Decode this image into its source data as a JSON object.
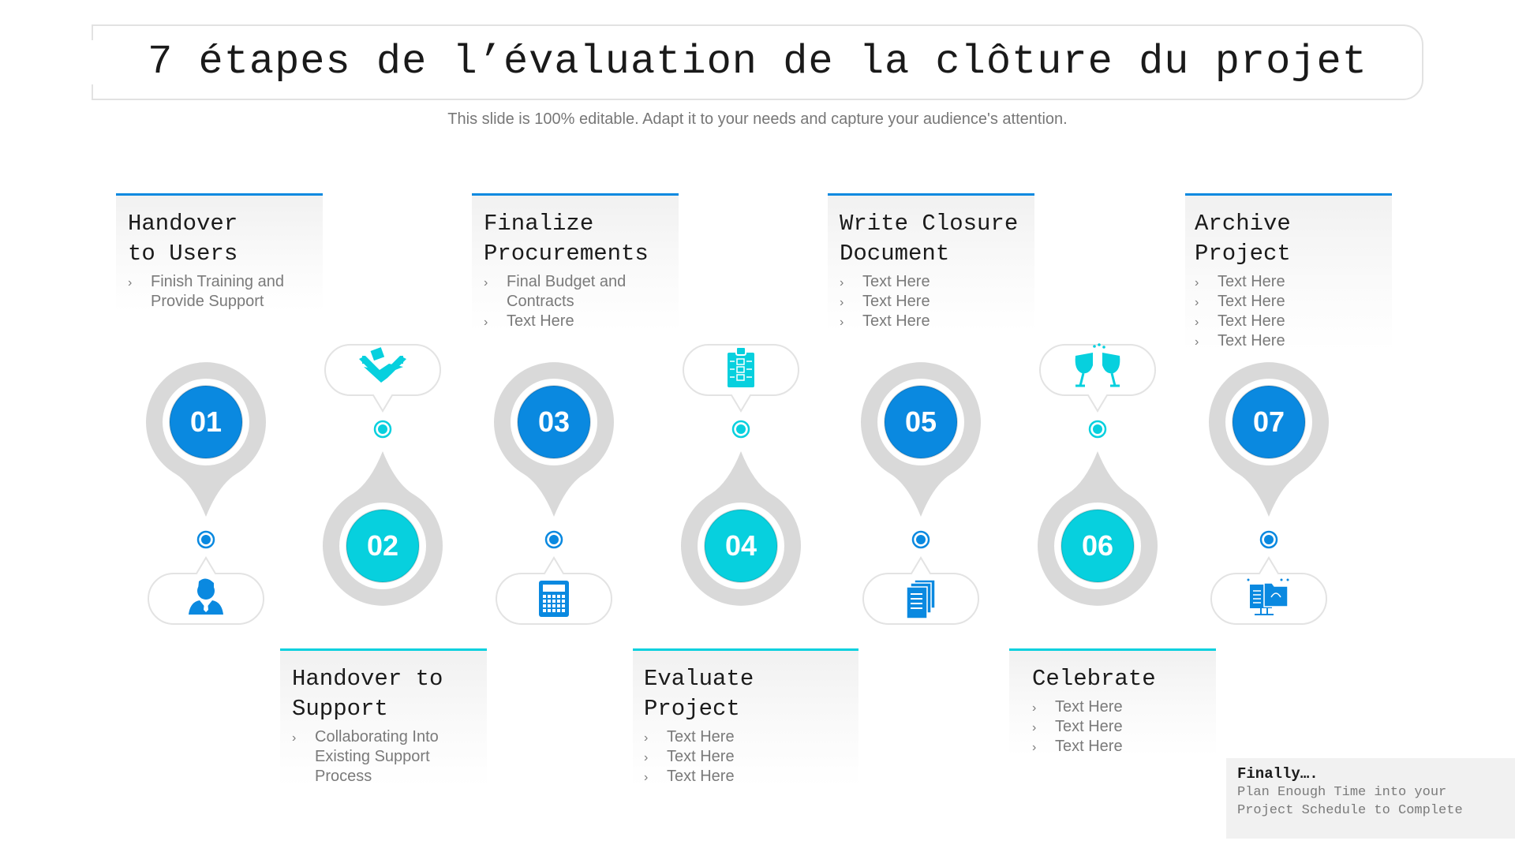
{
  "header": {
    "title": "7 étapes de l’évaluation de la clôture du projet",
    "subtitle": "This slide is 100% editable. Adapt it to your needs and capture your audience's attention."
  },
  "colors": {
    "blue": "#0a89e0",
    "cyan": "#07d0de",
    "pin_gray": "#d9d9d9",
    "bubble_border": "#e3e3e3"
  },
  "steps": [
    {
      "number": "01",
      "title": "Handover\nto Users",
      "bullets": [
        "Finish Training and Provide Support"
      ],
      "icon": "user-icon",
      "color": "blue"
    },
    {
      "number": "02",
      "title": "Handover to\nSupport",
      "bullets": [
        "Collaborating Into Existing Support Process"
      ],
      "icon": "handshake-icon",
      "color": "cyan"
    },
    {
      "number": "03",
      "title": "Finalize\nProcurements",
      "bullets": [
        "Final Budget and Contracts",
        "Text Here"
      ],
      "icon": "calculator-icon",
      "color": "blue"
    },
    {
      "number": "04",
      "title": "Evaluate Project",
      "bullets": [
        "Text Here",
        "Text Here",
        "Text Here"
      ],
      "icon": "checklist-icon",
      "color": "cyan"
    },
    {
      "number": "05",
      "title": "Write Closure\nDocument",
      "bullets": [
        "Text Here",
        "Text Here",
        "Text Here"
      ],
      "icon": "documents-icon",
      "color": "blue"
    },
    {
      "number": "06",
      "title": "Celebrate",
      "bullets": [
        "Text Here",
        "Text Here",
        "Text Here"
      ],
      "icon": "toast-glasses-icon",
      "color": "cyan"
    },
    {
      "number": "07",
      "title": "Archive Project",
      "bullets": [
        "Text Here",
        "Text Here",
        "Text Here",
        "Text Here"
      ],
      "icon": "archive-folder-icon",
      "color": "blue"
    }
  ],
  "bullet_glyph": "›",
  "footer_note": {
    "heading": "Finally….",
    "body": "Plan Enough Time into your\nProject Schedule to Complete"
  }
}
